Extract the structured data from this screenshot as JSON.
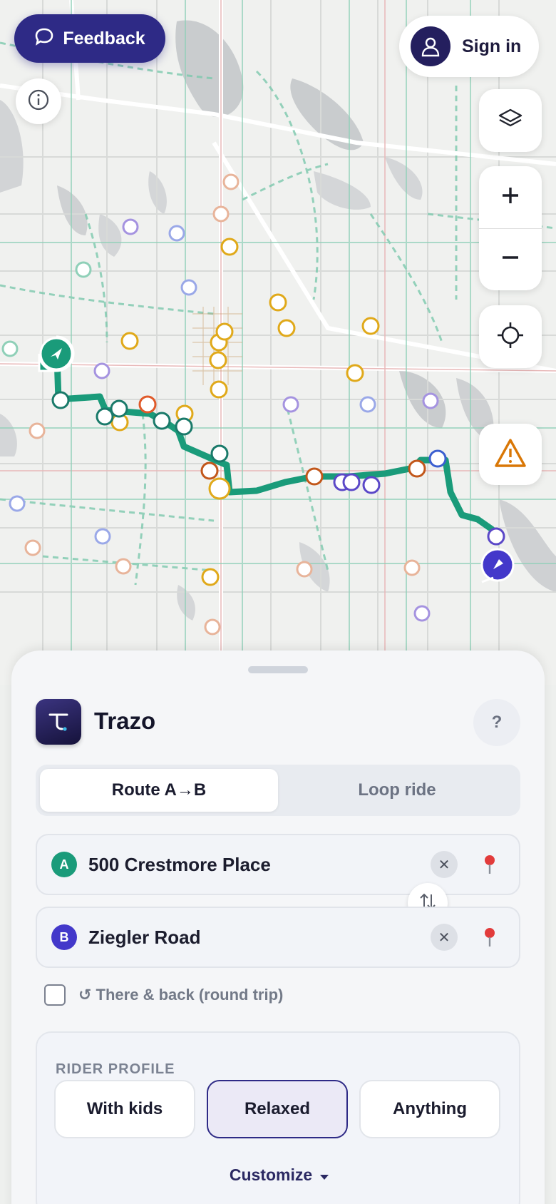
{
  "map": {
    "feedback_label": "Feedback",
    "signin_label": "Sign in",
    "info_glyph": "i",
    "zoom_in_glyph": "+",
    "zoom_out_glyph": "−",
    "route_color": "#1a9b7a",
    "start_color": "#1a9b7a",
    "end_color": "#4338ca",
    "warning_color": "#d97706",
    "icons": [
      "feedback-bubble-icon",
      "user-icon",
      "info-icon",
      "layers-icon",
      "plus-icon",
      "minus-icon",
      "crosshair-icon",
      "warning-icon",
      "start-marker-icon",
      "end-marker-icon"
    ]
  },
  "sheet": {
    "app_name": "Trazo",
    "help_glyph": "?",
    "tabs": [
      {
        "label": "Route A→B",
        "active": true
      },
      {
        "label": "Loop ride",
        "active": false
      }
    ],
    "origin": {
      "badge": "A",
      "value": "500 Crestmore Place",
      "badge_color": "#1a9b7a"
    },
    "destination": {
      "badge": "B",
      "value": "Ziegler Road",
      "badge_color": "#4338ca"
    },
    "clear_glyph": "✕",
    "round_trip": {
      "label": "↺ There & back (round trip)",
      "checked": false
    },
    "rider_profile": {
      "title": "RIDER PROFILE",
      "options": [
        {
          "label": "With kids",
          "selected": false
        },
        {
          "label": "Relaxed",
          "selected": true
        },
        {
          "label": "Anything",
          "selected": false
        }
      ],
      "customize_label": "Customize"
    }
  }
}
